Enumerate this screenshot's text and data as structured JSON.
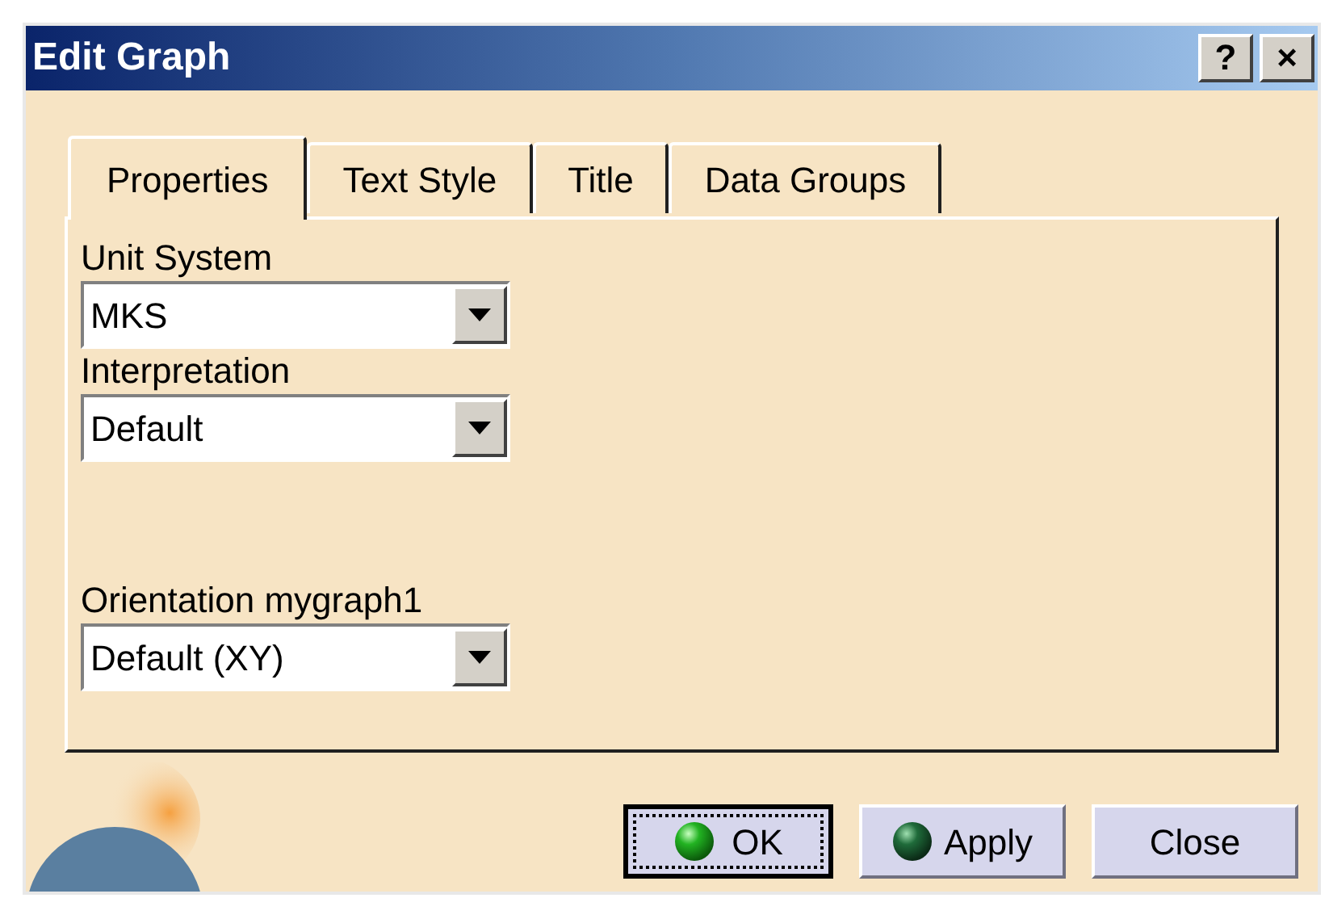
{
  "window": {
    "title": "Edit Graph",
    "title_buttons": [
      "?",
      "×"
    ]
  },
  "tabs": [
    {
      "label": "Properties",
      "selected": true
    },
    {
      "label": "Text Style",
      "selected": false
    },
    {
      "label": "Title",
      "selected": false
    },
    {
      "label": "Data Groups",
      "selected": false
    }
  ],
  "fields": [
    {
      "label": "Unit System",
      "value": "MKS"
    },
    {
      "label": "Interpretation",
      "value": "Default"
    },
    {
      "label": "Orientation mygraph1",
      "value": "Default (XY)"
    }
  ],
  "buttons": [
    {
      "label": "OK",
      "focused": true
    },
    {
      "label": "Apply",
      "focused": false
    },
    {
      "label": "Close",
      "focused": false
    }
  ]
}
